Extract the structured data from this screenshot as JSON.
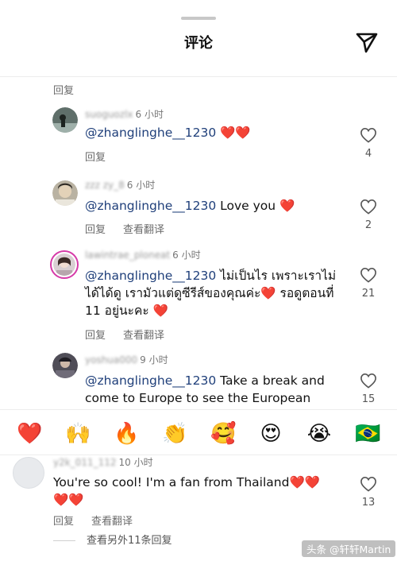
{
  "header": {
    "title": "评论"
  },
  "top_reply_label": "回复",
  "comments": [
    {
      "username": "suoguozlx",
      "time": "6 小时",
      "mention": "@zhanglinghe__1230",
      "text": " ❤️❤️",
      "reply": "回复",
      "translate": "",
      "likes": "4"
    },
    {
      "username": "zzz zy_8",
      "time": "6 小时",
      "mention": "@zhanglinghe__1230",
      "text": " Love you ❤️",
      "reply": "回复",
      "translate": "查看翻译",
      "likes": "2"
    },
    {
      "username": "lawintrae_ploneat",
      "time": "6 小时",
      "mention": "@zhanglinghe__1230",
      "text": "  ไม่เป็นไร เพราะเราไม่ได้ได้ดู  เรามัวแต่ดูซีรีส์ของคุณค่ะ❤️ รอดูตอนที่ 11 อยู่นะคะ ❤️",
      "reply": "回复",
      "translate": "查看翻译",
      "likes": "21"
    },
    {
      "username": "yoshua000",
      "time": "9 小时",
      "mention": "@zhanglinghe__1230",
      "text": " Take a break and come to Europe to see the European landscape and feel the warmth of the",
      "reply": "",
      "translate": "",
      "likes": "15"
    },
    {
      "username": "y2k_011_112",
      "time": "10 小时",
      "mention": "",
      "text": "You're so cool! I'm a fan from Thailand❤️❤️❤️❤️",
      "reply": "回复",
      "translate": "查看翻译",
      "likes": "13"
    }
  ],
  "emoji_bar": [
    "❤️",
    "🙌",
    "🔥",
    "👏",
    "🥰",
    "😍",
    "😭",
    "🇧🇷"
  ],
  "view_more": "查看另外11条回复",
  "watermark": "头条 @轩轩Martin"
}
